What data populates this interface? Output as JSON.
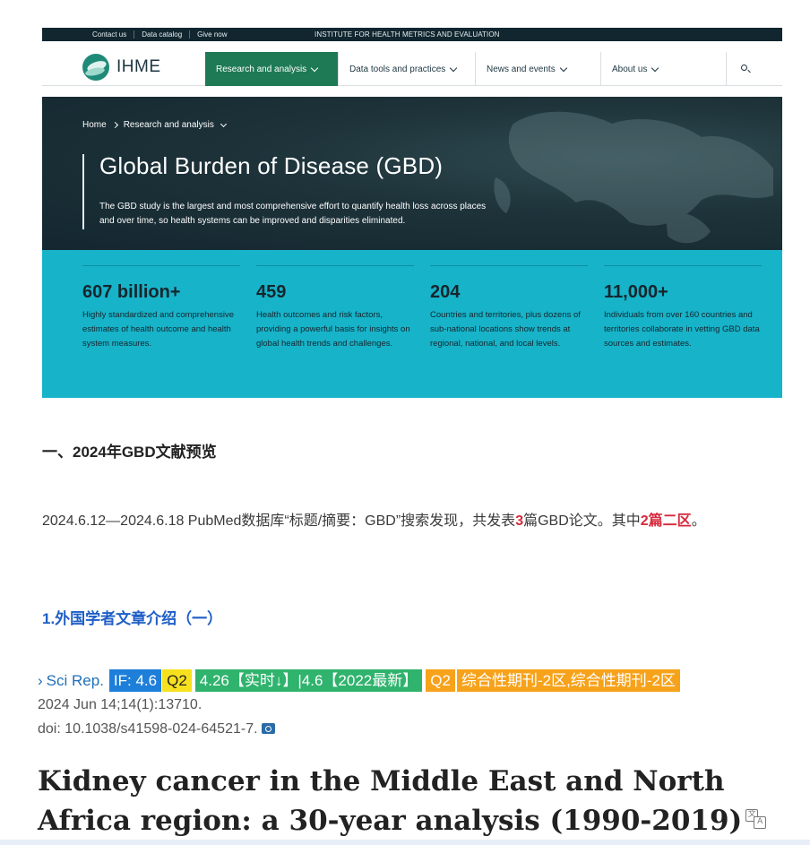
{
  "ihme": {
    "top_links": [
      "Contact us",
      "Data catalog",
      "Give now"
    ],
    "institute": "INSTITUTE FOR HEALTH METRICS AND EVALUATION",
    "logo_text": "IHME",
    "nav": [
      "Research and analysis",
      "Data tools and practices",
      "News and events",
      "About us"
    ],
    "breadcrumb": {
      "home": "Home",
      "current": "Research and analysis"
    },
    "hero_title": "Global Burden of Disease (GBD)",
    "hero_text": "The GBD study is the largest and most comprehensive effort to quantify health loss across places and over time, so health systems can be improved and disparities eliminated.",
    "stats": [
      {
        "num": "607 billion+",
        "desc": "Highly standardized and comprehensive estimates of health outcome and health system measures."
      },
      {
        "num": "459",
        "desc": "Health outcomes and risk factors, providing a powerful basis for insights on global health trends and challenges."
      },
      {
        "num": "204",
        "desc": "Countries and territories, plus dozens of sub-national locations show trends at regional, national, and local levels."
      },
      {
        "num": "11,000+",
        "desc": "Individuals from over 160 countries and territories collaborate in vetting GBD data sources and estimates."
      }
    ],
    "colors": {
      "topbar": "#11262f",
      "nav_active": "#1e7a54",
      "stats_bg": "#17b3c9"
    }
  },
  "article": {
    "section_heading": "一、2024年GBD文献预览",
    "para_a": "2024.6.12—2024.6.18 PubMed数据库“标题/摘要：GBD”搜索发现，共发表",
    "para_num1": "3",
    "para_b": "篇GBD论文。其中",
    "para_red2": "2篇二区",
    "para_end": "。",
    "sub_heading": "1.外国学者文章介绍（一）",
    "journal": {
      "name": "Sci Rep.",
      "if_tag": "IF: 4.6",
      "q_tag": "Q2",
      "realtime_tag": "4.26【实时↓】|4.6【2022最新】",
      "q_tag2": "Q2",
      "zone_tag": "综合性期刊-2区,综合性期刊-2区"
    },
    "date_line": "2024 Jun 14;14(1):13710.",
    "doi_line": "doi: 10.1038/s41598-024-64521-7.",
    "title": "Kidney cancer in the Middle East and North Africa region: a 30-year analysis (1990-2019)",
    "colors": {
      "red": "#d6283b",
      "blue_heading": "#1f5fc6"
    }
  }
}
